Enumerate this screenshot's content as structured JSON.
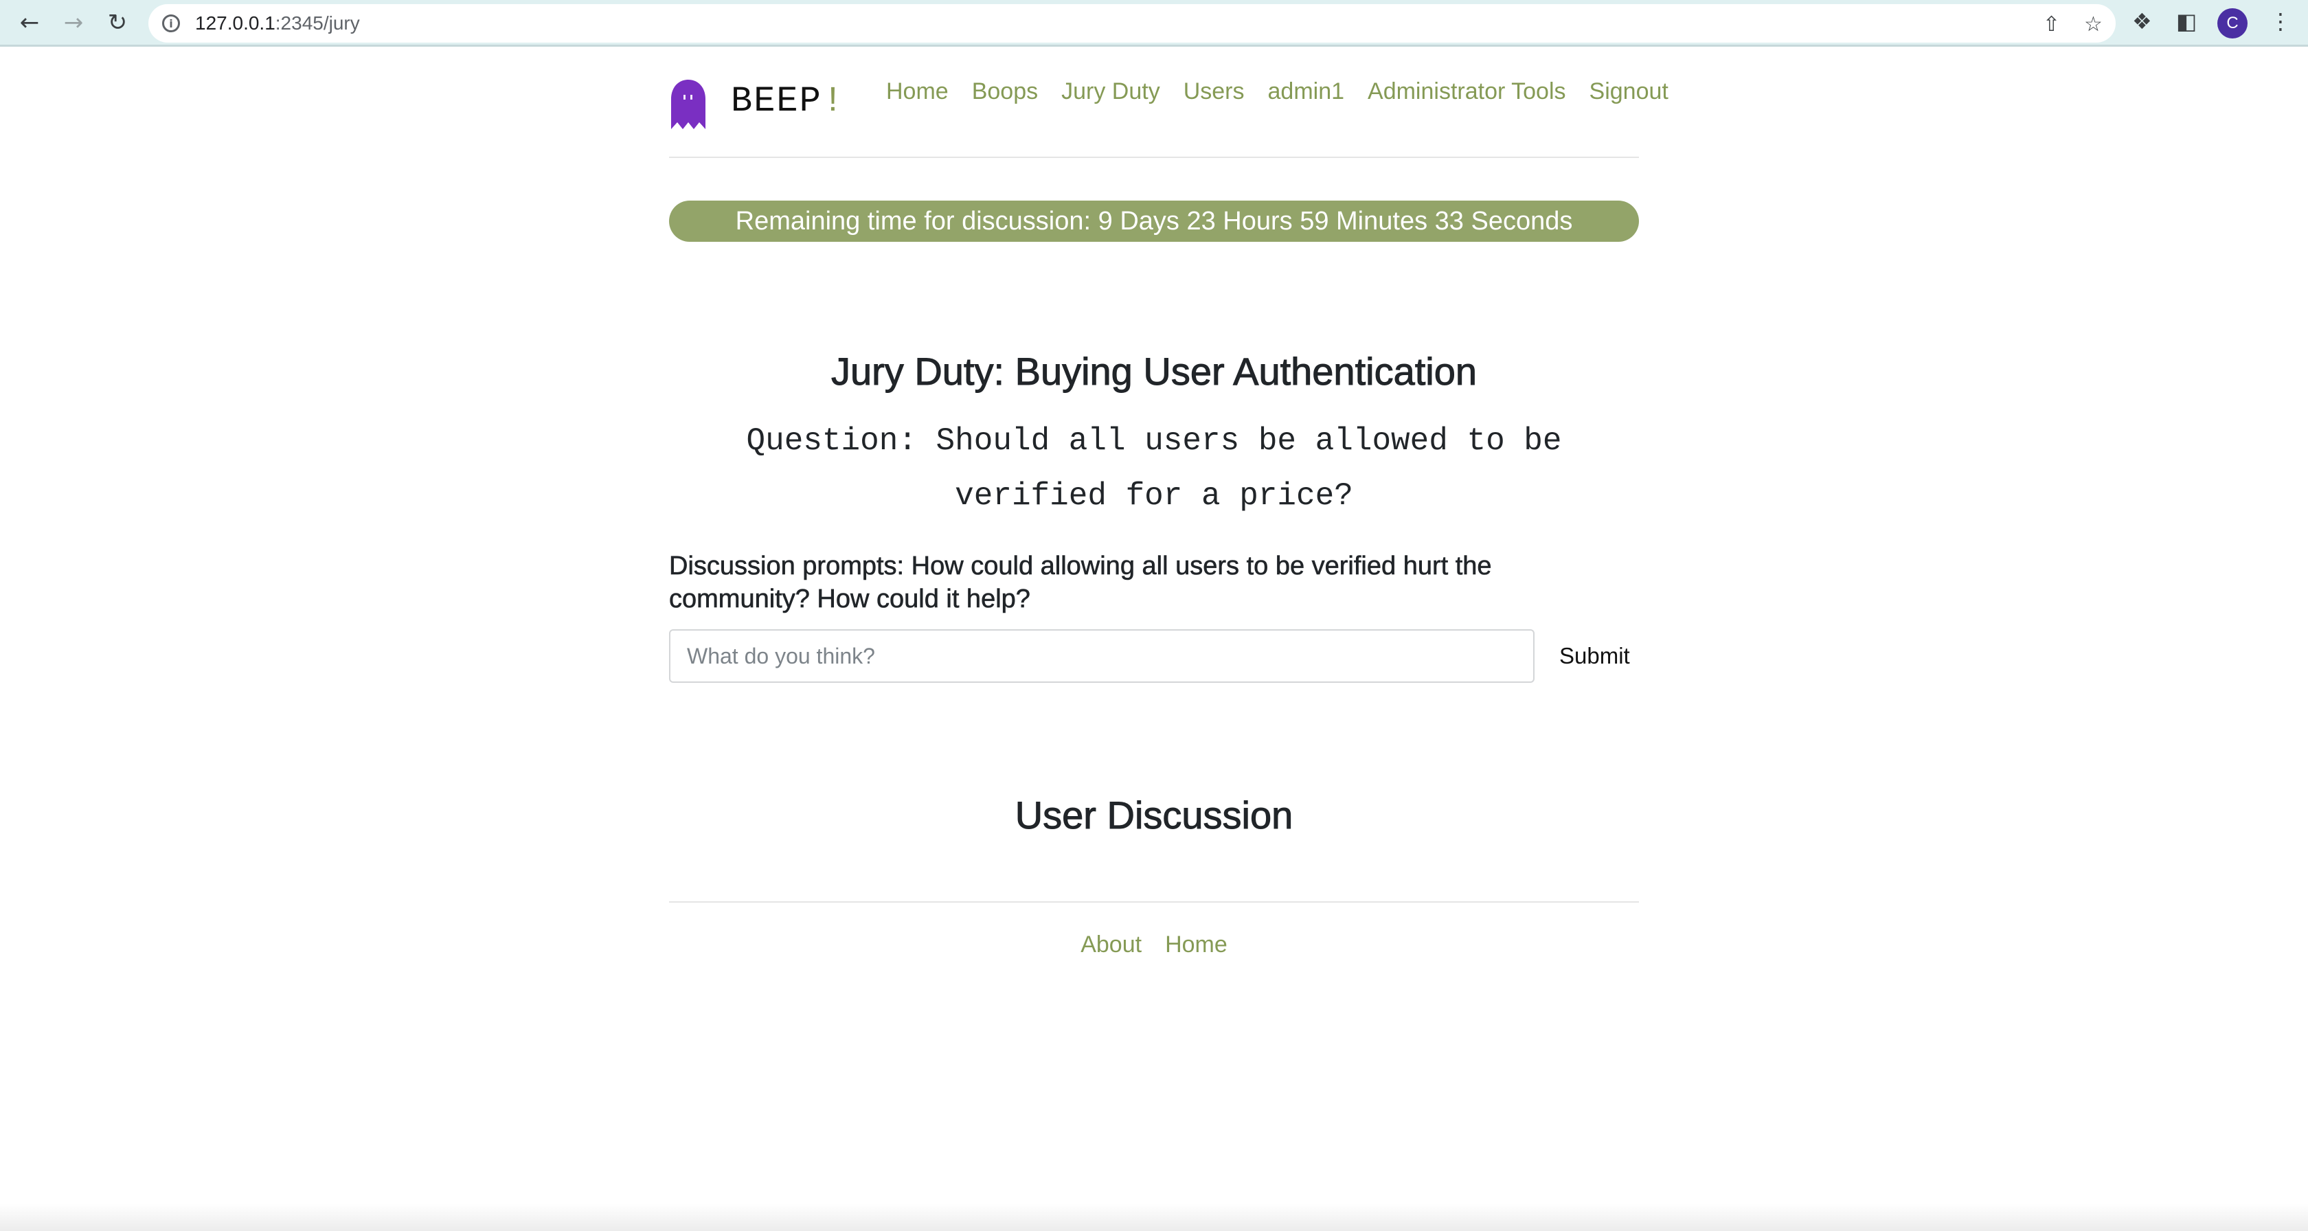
{
  "browser": {
    "url_host": "127.0.0.1",
    "url_path": ":2345/jury",
    "profile_initial": "C"
  },
  "site": {
    "brand_name": "BEEP",
    "brand_mark": "!",
    "logo_color": "#7a2fc2",
    "accent_color": "#859a55"
  },
  "nav": {
    "items": [
      "Home",
      "Boops",
      "Jury Duty",
      "Users",
      "admin1",
      "Administrator Tools",
      "Signout"
    ]
  },
  "timer": {
    "text": "Remaining time for discussion: 9 Days 23 Hours 59 Minutes 33 Seconds",
    "color": "#93a469"
  },
  "jury": {
    "title": "Jury Duty: Buying User Authentication",
    "question": "Question: Should all users be allowed to be verified for a price?",
    "prompts": "Discussion prompts: How could allowing all users to be verified hurt the community? How could it help?"
  },
  "comment_form": {
    "value": "",
    "placeholder": "What do you think?",
    "submit_label": "Submit"
  },
  "discussion": {
    "title": "User Discussion"
  },
  "footer": {
    "links": [
      "About",
      "Home"
    ]
  }
}
